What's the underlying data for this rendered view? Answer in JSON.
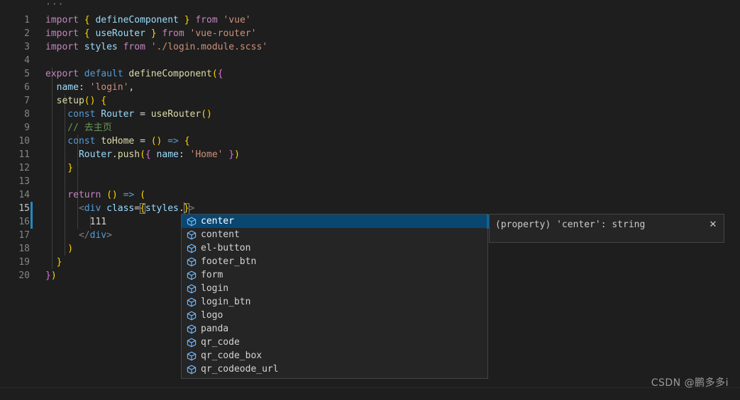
{
  "editor": {
    "fold_indicator": "···",
    "lines": [
      {
        "num": "1",
        "text": "import { defineComponent } from 'vue'"
      },
      {
        "num": "2",
        "text": "import { useRouter } from 'vue-router'"
      },
      {
        "num": "3",
        "text": "import styles from './login.module.scss'"
      },
      {
        "num": "4",
        "text": ""
      },
      {
        "num": "5",
        "text": "export default defineComponent({"
      },
      {
        "num": "6",
        "text": "  name: 'login',"
      },
      {
        "num": "7",
        "text": "  setup() {"
      },
      {
        "num": "8",
        "text": "    const Router = useRouter()"
      },
      {
        "num": "9",
        "text": "    // 去主页"
      },
      {
        "num": "10",
        "text": "    const toHome = () => {"
      },
      {
        "num": "11",
        "text": "      Router.push({ name: 'Home' })"
      },
      {
        "num": "12",
        "text": "    }"
      },
      {
        "num": "13",
        "text": ""
      },
      {
        "num": "14",
        "text": "    return () => ("
      },
      {
        "num": "15",
        "text": "      <div class={styles.}>"
      },
      {
        "num": "16",
        "text": "        111"
      },
      {
        "num": "17",
        "text": "      </div>"
      },
      {
        "num": "18",
        "text": "    )"
      },
      {
        "num": "19",
        "text": "  }"
      },
      {
        "num": "20",
        "text": "})"
      }
    ],
    "active_line": "15"
  },
  "suggest": {
    "icon_name": "property-cube-icon",
    "selected_index": 0,
    "items": [
      {
        "label": "center"
      },
      {
        "label": "content"
      },
      {
        "label": "el-button"
      },
      {
        "label": "footer_btn"
      },
      {
        "label": "form"
      },
      {
        "label": "login"
      },
      {
        "label": "login_btn"
      },
      {
        "label": "logo"
      },
      {
        "label": "panda"
      },
      {
        "label": "qr_code"
      },
      {
        "label": "qr_code_box"
      },
      {
        "label": "qr_codeode_url"
      }
    ]
  },
  "details": {
    "signature": "(property) 'center': string",
    "close_label": "✕"
  },
  "watermark": {
    "text": "CSDN @鹏多多i"
  },
  "colors": {
    "background": "#1e1e1e",
    "selection": "#094771",
    "widget_bg": "#252526",
    "widget_border": "#454545",
    "keyword": "#c586c0",
    "declaration": "#569cd6",
    "identifier": "#9cdcfe",
    "string": "#ce9178",
    "comment": "#6a9955",
    "function": "#dcdcaa",
    "icon_blue": "#75beff",
    "error_underline": "#f14c4c"
  }
}
